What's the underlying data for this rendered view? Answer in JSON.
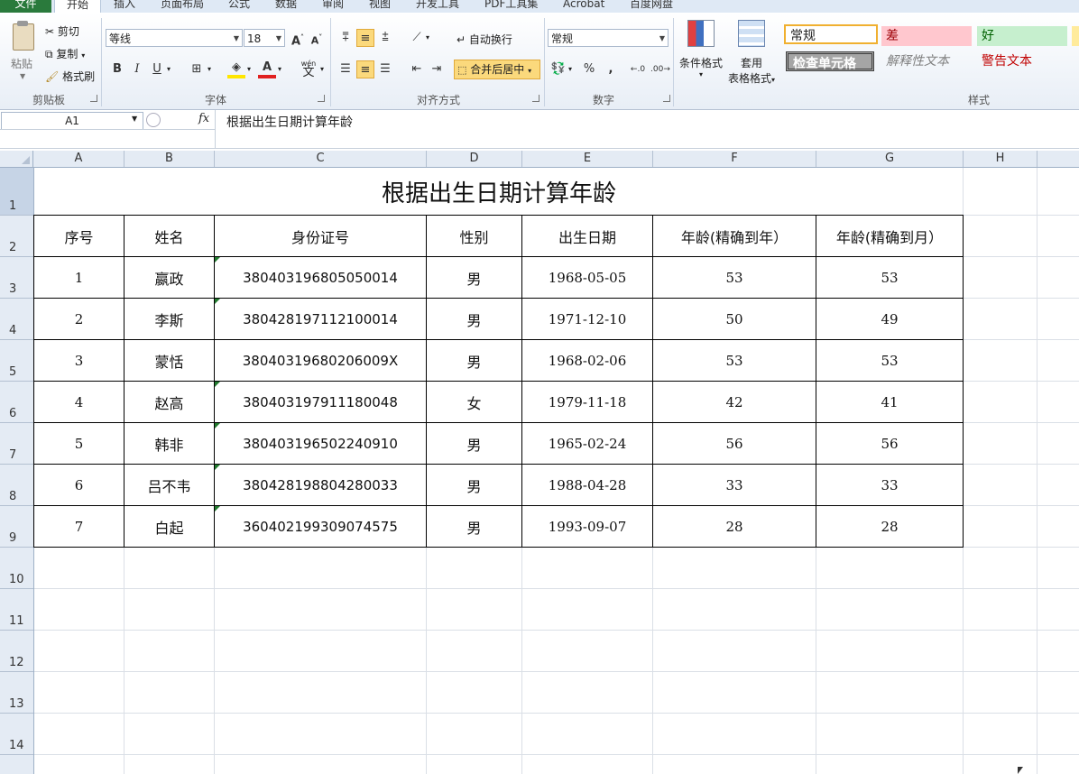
{
  "tabs": [
    "文件",
    "开始",
    "插入",
    "页面布局",
    "公式",
    "数据",
    "审阅",
    "视图",
    "开发工具",
    "PDF工具集",
    "Acrobat",
    "百度网盘"
  ],
  "ribbon": {
    "clipboard": {
      "paste": "粘贴",
      "cut": "剪切",
      "copy": "复制",
      "format_painter": "格式刷",
      "label": "剪贴板"
    },
    "font": {
      "name": "等线",
      "size": "18",
      "label": "字体",
      "wen": "wén",
      "wen_char": "文"
    },
    "alignment": {
      "wrap": "自动换行",
      "merge": "合并后居中",
      "label": "对齐方式"
    },
    "number": {
      "format": "常规",
      "percent": "%",
      "comma": ",",
      "label": "数字"
    },
    "styles": {
      "conditional": "条件格式",
      "table_fmt_1": "套用",
      "table_fmt_2": "表格格式",
      "normal": "常规",
      "bad": "差",
      "good": "好",
      "check_cell": "检查单元格",
      "explanatory": "解释性文本",
      "warning": "警告文本",
      "label": "样式"
    }
  },
  "formula_bar": {
    "name_box": "A1",
    "fx": "fx",
    "content": "根据出生日期计算年龄"
  },
  "columns": [
    "A",
    "B",
    "C",
    "D",
    "E",
    "F",
    "G",
    "H"
  ],
  "rows": [
    "1",
    "2",
    "3",
    "4",
    "5",
    "6",
    "7",
    "8",
    "9",
    "10",
    "11",
    "12",
    "13",
    "14"
  ],
  "sheet": {
    "title": "根据出生日期计算年龄",
    "headers": [
      "序号",
      "姓名",
      "身份证号",
      "性别",
      "出生日期",
      "年龄(精确到年）",
      "年龄(精确到月）"
    ],
    "records": [
      [
        "1",
        "嬴政",
        "380403196805050014",
        "男",
        "1968-05-05",
        "53",
        "53"
      ],
      [
        "2",
        "李斯",
        "380428197112100014",
        "男",
        "1971-12-10",
        "50",
        "49"
      ],
      [
        "3",
        "蒙恬",
        "38040319680206009X",
        "男",
        "1968-02-06",
        "53",
        "53"
      ],
      [
        "4",
        "赵高",
        "380403197911180048",
        "女",
        "1979-11-18",
        "42",
        "41"
      ],
      [
        "5",
        "韩非",
        "380403196502240910",
        "男",
        "1965-02-24",
        "56",
        "56"
      ],
      [
        "6",
        "吕不韦",
        "380428198804280033",
        "男",
        "1988-04-28",
        "33",
        "33"
      ],
      [
        "7",
        "白起",
        "360402199309074575",
        "男",
        "1993-09-07",
        "28",
        "28"
      ]
    ]
  },
  "colors": {
    "accent": "#2a7a3c",
    "active_button": "#fbd97c",
    "bad_bg": "#ffc7ce",
    "good_bg": "#c6efce",
    "warning_text": "#c00000"
  }
}
